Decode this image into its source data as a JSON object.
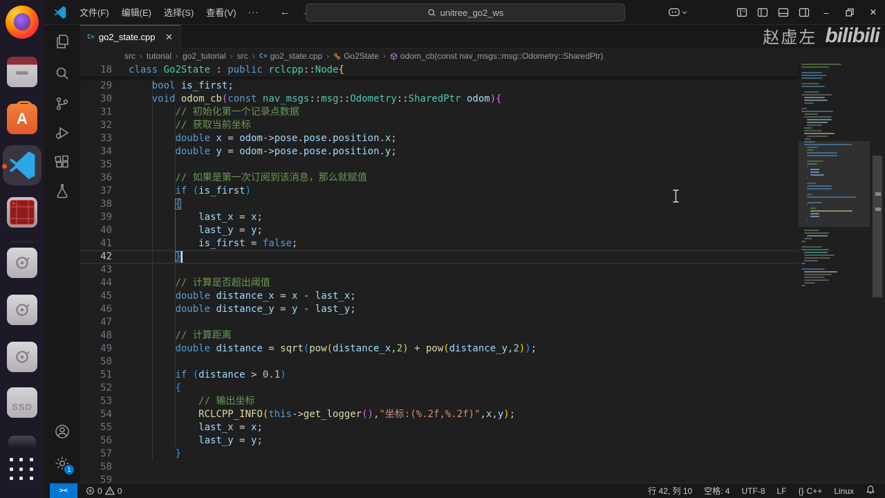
{
  "titlebar": {
    "menus": [
      "文件(F)",
      "编辑(E)",
      "选择(S)",
      "查看(V)"
    ],
    "overflow_label": "···",
    "back_label": "←",
    "forward_label": "→",
    "search": {
      "value": "unitree_go2_ws"
    },
    "icons": [
      "vscode-logo",
      "copilot-icon",
      "customize-layout-icon",
      "toggle-sidebar-icon",
      "toggle-panel-icon",
      "toggle-secondary-sidebar-icon"
    ],
    "window_controls": {
      "minimize": "–",
      "restore": "restore-icon",
      "close": "✕"
    }
  },
  "watermark": {
    "author": "赵虚左",
    "brand": "bilibili"
  },
  "dock": {
    "items": [
      "firefox",
      "files",
      "software-store",
      "vscode-active",
      "terminal",
      "disk-1",
      "disk-2",
      "disk-3",
      "ssd-drive",
      "hidden-app",
      "show-applications"
    ],
    "ssd_label": "SSD"
  },
  "activity_bar": {
    "items": [
      "explorer",
      "search",
      "source-control",
      "run-debug",
      "extensions",
      "testing",
      "account",
      "settings"
    ],
    "settings_badge": "1"
  },
  "tab": {
    "label": "go2_state.cpp",
    "close": "✕",
    "icon": "C+"
  },
  "breadcrumbs": [
    {
      "label": "src",
      "icon": ""
    },
    {
      "label": "tutorial",
      "icon": ""
    },
    {
      "label": "go2_tutorial",
      "icon": ""
    },
    {
      "label": "src",
      "icon": ""
    },
    {
      "label": "go2_state.cpp",
      "icon": "cpp"
    },
    {
      "label": "Go2State",
      "icon": "class"
    },
    {
      "label": "odom_cb(const nav_msgs::msg::Odometry::SharedPtr)",
      "icon": "method"
    }
  ],
  "editor": {
    "cursor_line": 42,
    "cursor_col": 10,
    "sticky": {
      "n": 18,
      "s": [
        [
          "class",
          "kw"
        ],
        [
          " ",
          "txt"
        ],
        [
          "Go2State",
          "type"
        ],
        [
          " : ",
          "txt"
        ],
        [
          "public",
          "kw"
        ],
        [
          " ",
          "txt"
        ],
        [
          "rclcpp",
          "type"
        ],
        [
          "::",
          "txt"
        ],
        [
          "Node",
          "type"
        ],
        [
          "{",
          "b1"
        ]
      ]
    },
    "lines": [
      {
        "n": 29,
        "s": [
          [
            "    ",
            "txt"
          ],
          [
            "bool",
            "kw"
          ],
          [
            " ",
            "txt"
          ],
          [
            "is_first",
            "var"
          ],
          [
            ";",
            "txt"
          ]
        ]
      },
      {
        "n": 30,
        "s": [
          [
            "    ",
            "txt"
          ],
          [
            "void",
            "kw"
          ],
          [
            " ",
            "txt"
          ],
          [
            "odom_cb",
            "fn"
          ],
          [
            "(",
            "b2"
          ],
          [
            "const",
            "kw"
          ],
          [
            " ",
            "txt"
          ],
          [
            "nav_msgs",
            "type"
          ],
          [
            "::",
            "txt"
          ],
          [
            "msg",
            "type"
          ],
          [
            "::",
            "txt"
          ],
          [
            "Odometry",
            "type"
          ],
          [
            "::",
            "txt"
          ],
          [
            "SharedPtr",
            "type"
          ],
          [
            " ",
            "txt"
          ],
          [
            "odom",
            "var"
          ],
          [
            ")",
            "b2"
          ],
          [
            "{",
            "b2"
          ]
        ]
      },
      {
        "n": 31,
        "s": [
          [
            "        ",
            "txt"
          ],
          [
            "// 初始化第一个记录点数据",
            "cm"
          ]
        ]
      },
      {
        "n": 32,
        "s": [
          [
            "        ",
            "txt"
          ],
          [
            "// 获取当前坐标",
            "cm"
          ]
        ]
      },
      {
        "n": 33,
        "s": [
          [
            "        ",
            "txt"
          ],
          [
            "double",
            "kw"
          ],
          [
            " ",
            "txt"
          ],
          [
            "x",
            "var"
          ],
          [
            " = ",
            "txt"
          ],
          [
            "odom",
            "var"
          ],
          [
            "->",
            "txt"
          ],
          [
            "pose",
            "var"
          ],
          [
            ".",
            "txt"
          ],
          [
            "pose",
            "var"
          ],
          [
            ".",
            "txt"
          ],
          [
            "position",
            "var"
          ],
          [
            ".",
            "txt"
          ],
          [
            "x",
            "var"
          ],
          [
            ";",
            "txt"
          ]
        ]
      },
      {
        "n": 34,
        "s": [
          [
            "        ",
            "txt"
          ],
          [
            "double",
            "kw"
          ],
          [
            " ",
            "txt"
          ],
          [
            "y",
            "var"
          ],
          [
            " = ",
            "txt"
          ],
          [
            "odom",
            "var"
          ],
          [
            "->",
            "txt"
          ],
          [
            "pose",
            "var"
          ],
          [
            ".",
            "txt"
          ],
          [
            "pose",
            "var"
          ],
          [
            ".",
            "txt"
          ],
          [
            "position",
            "var"
          ],
          [
            ".",
            "txt"
          ],
          [
            "y",
            "var"
          ],
          [
            ";",
            "txt"
          ]
        ]
      },
      {
        "n": 35,
        "s": []
      },
      {
        "n": 36,
        "s": [
          [
            "        ",
            "txt"
          ],
          [
            "// 如果是第一次订阅到该消息，那么就赋值",
            "cm"
          ]
        ]
      },
      {
        "n": 37,
        "s": [
          [
            "        ",
            "txt"
          ],
          [
            "if",
            "kw"
          ],
          [
            " ",
            "txt"
          ],
          [
            "(",
            "b3"
          ],
          [
            "is_first",
            "var"
          ],
          [
            ")",
            "b3"
          ]
        ]
      },
      {
        "n": 38,
        "s": [
          [
            "        ",
            "txt"
          ],
          [
            "{",
            "b3m"
          ]
        ]
      },
      {
        "n": 39,
        "s": [
          [
            "            ",
            "txt"
          ],
          [
            "last_x",
            "var"
          ],
          [
            " = ",
            "txt"
          ],
          [
            "x",
            "var"
          ],
          [
            ";",
            "txt"
          ]
        ]
      },
      {
        "n": 40,
        "s": [
          [
            "            ",
            "txt"
          ],
          [
            "last_y",
            "var"
          ],
          [
            " = ",
            "txt"
          ],
          [
            "y",
            "var"
          ],
          [
            ";",
            "txt"
          ]
        ]
      },
      {
        "n": 41,
        "s": [
          [
            "            ",
            "txt"
          ],
          [
            "is_first",
            "var"
          ],
          [
            " = ",
            "txt"
          ],
          [
            "false",
            "kw"
          ],
          [
            ";",
            "txt"
          ]
        ]
      },
      {
        "n": 42,
        "s": [
          [
            "        ",
            "txt"
          ],
          [
            "}",
            "b3m"
          ]
        ]
      },
      {
        "n": 43,
        "s": []
      },
      {
        "n": 44,
        "s": [
          [
            "        ",
            "txt"
          ],
          [
            "// 计算是否超出阈值",
            "cm"
          ]
        ]
      },
      {
        "n": 45,
        "s": [
          [
            "        ",
            "txt"
          ],
          [
            "double",
            "kw"
          ],
          [
            " ",
            "txt"
          ],
          [
            "distance_x",
            "var"
          ],
          [
            " = ",
            "txt"
          ],
          [
            "x",
            "var"
          ],
          [
            " - ",
            "txt"
          ],
          [
            "last_x",
            "var"
          ],
          [
            ";",
            "txt"
          ]
        ]
      },
      {
        "n": 46,
        "s": [
          [
            "        ",
            "txt"
          ],
          [
            "double",
            "kw"
          ],
          [
            " ",
            "txt"
          ],
          [
            "distance_y",
            "var"
          ],
          [
            " = ",
            "txt"
          ],
          [
            "y",
            "var"
          ],
          [
            " - ",
            "txt"
          ],
          [
            "last_y",
            "var"
          ],
          [
            ";",
            "txt"
          ]
        ]
      },
      {
        "n": 47,
        "s": []
      },
      {
        "n": 48,
        "s": [
          [
            "        ",
            "txt"
          ],
          [
            "// 计算距离",
            "cm"
          ]
        ]
      },
      {
        "n": 49,
        "s": [
          [
            "        ",
            "txt"
          ],
          [
            "double",
            "kw"
          ],
          [
            " ",
            "txt"
          ],
          [
            "distance",
            "var"
          ],
          [
            " = ",
            "txt"
          ],
          [
            "sqrt",
            "fn"
          ],
          [
            "(",
            "b3"
          ],
          [
            "pow",
            "fn"
          ],
          [
            "(",
            "b1"
          ],
          [
            "distance_x",
            "var"
          ],
          [
            ",",
            "txt"
          ],
          [
            "2",
            "num"
          ],
          [
            ")",
            "b1"
          ],
          [
            " + ",
            "txt"
          ],
          [
            "pow",
            "fn"
          ],
          [
            "(",
            "b1"
          ],
          [
            "distance_y",
            "var"
          ],
          [
            ",",
            "txt"
          ],
          [
            "2",
            "num"
          ],
          [
            ")",
            "b1"
          ],
          [
            ")",
            "b3"
          ],
          [
            ";",
            "txt"
          ]
        ]
      },
      {
        "n": 50,
        "s": []
      },
      {
        "n": 51,
        "s": [
          [
            "        ",
            "txt"
          ],
          [
            "if",
            "kw"
          ],
          [
            " ",
            "txt"
          ],
          [
            "(",
            "b3"
          ],
          [
            "distance",
            "var"
          ],
          [
            " > ",
            "txt"
          ],
          [
            "0.1",
            "num"
          ],
          [
            ")",
            "b3"
          ]
        ]
      },
      {
        "n": 52,
        "s": [
          [
            "        ",
            "txt"
          ],
          [
            "{",
            "b3"
          ]
        ]
      },
      {
        "n": 53,
        "s": [
          [
            "            ",
            "txt"
          ],
          [
            "// 输出坐标",
            "cm"
          ]
        ]
      },
      {
        "n": 54,
        "s": [
          [
            "            ",
            "txt"
          ],
          [
            "RCLCPP_INFO",
            "fn"
          ],
          [
            "(",
            "b1"
          ],
          [
            "this",
            "kw"
          ],
          [
            "->",
            "txt"
          ],
          [
            "get_logger",
            "fn"
          ],
          [
            "(",
            "b2"
          ],
          [
            ")",
            "b2"
          ],
          [
            ",",
            "txt"
          ],
          [
            "\"坐标:(%.2f,%.2f)\"",
            "str"
          ],
          [
            ",",
            "txt"
          ],
          [
            "x",
            "var"
          ],
          [
            ",",
            "txt"
          ],
          [
            "y",
            "var"
          ],
          [
            ")",
            "b1"
          ],
          [
            ";",
            "txt"
          ]
        ]
      },
      {
        "n": 55,
        "s": [
          [
            "            ",
            "txt"
          ],
          [
            "last_x",
            "var"
          ],
          [
            " = ",
            "txt"
          ],
          [
            "x",
            "var"
          ],
          [
            ";",
            "txt"
          ]
        ]
      },
      {
        "n": 56,
        "s": [
          [
            "            ",
            "txt"
          ],
          [
            "last_y",
            "var"
          ],
          [
            " = ",
            "txt"
          ],
          [
            "y",
            "var"
          ],
          [
            ";",
            "txt"
          ]
        ]
      },
      {
        "n": 57,
        "s": [
          [
            "        ",
            "txt"
          ],
          [
            "}",
            "b3"
          ]
        ]
      },
      {
        "n": 58,
        "s": []
      },
      {
        "n": 59,
        "s": []
      }
    ],
    "minimap": {
      "upper": [
        [
          0,
          58,
          "cm"
        ],
        [
          0,
          40,
          "cm"
        ],
        [
          0,
          0,
          "txt"
        ],
        [
          0,
          30,
          "kw"
        ],
        [
          0,
          36,
          "kw"
        ],
        [
          0,
          30,
          "kw"
        ],
        [
          0,
          0,
          "txt"
        ],
        [
          0,
          26,
          "cm"
        ],
        [
          0,
          34,
          "kw"
        ],
        [
          0,
          0,
          "txt"
        ],
        [
          4,
          22,
          "cm"
        ],
        [
          0,
          44,
          "txt"
        ],
        [
          4,
          30,
          "var"
        ],
        [
          4,
          34,
          "var"
        ],
        [
          4,
          14,
          "txt"
        ],
        [
          0,
          0,
          "txt"
        ],
        [
          0,
          8,
          "txt"
        ],
        [
          0,
          46,
          "kw"
        ],
        [
          4,
          20,
          "cm"
        ],
        [
          4,
          40,
          "txt"
        ],
        [
          8,
          36,
          "var"
        ],
        [
          8,
          30,
          "var"
        ],
        [
          8,
          22,
          "txt"
        ],
        [
          4,
          12,
          "txt"
        ],
        [
          4,
          26,
          "cm"
        ],
        [
          4,
          44,
          "fn"
        ],
        [
          8,
          30,
          "txt"
        ],
        [
          4,
          10,
          "txt"
        ]
      ],
      "lower": [
        [
          4,
          0,
          "txt"
        ],
        [
          4,
          22,
          "cm"
        ],
        [
          4,
          36,
          "txt"
        ],
        [
          8,
          30,
          "var"
        ],
        [
          4,
          12,
          "txt"
        ],
        [
          0,
          6,
          "txt"
        ],
        [
          0,
          0,
          "txt"
        ],
        [
          0,
          30,
          "cm"
        ],
        [
          0,
          40,
          "kw"
        ],
        [
          4,
          34,
          "type"
        ],
        [
          4,
          44,
          "txt"
        ],
        [
          4,
          38,
          "txt"
        ],
        [
          4,
          20,
          "txt"
        ],
        [
          0,
          6,
          "txt"
        ],
        [
          0,
          0,
          "txt"
        ],
        [
          0,
          34,
          "kw"
        ],
        [
          4,
          48,
          "fn"
        ],
        [
          4,
          40,
          "txt"
        ],
        [
          4,
          30,
          "txt"
        ],
        [
          4,
          36,
          "txt"
        ],
        [
          4,
          16,
          "txt"
        ],
        [
          0,
          6,
          "txt"
        ],
        [
          0,
          0,
          "txt"
        ],
        [
          0,
          0,
          "txt"
        ],
        [
          0,
          0,
          "txt"
        ],
        [
          0,
          0,
          "txt"
        ],
        [
          0,
          0,
          "txt"
        ],
        [
          0,
          0,
          "txt"
        ],
        [
          0,
          0,
          "txt"
        ],
        [
          0,
          0,
          "txt"
        ],
        [
          0,
          0,
          "txt"
        ]
      ]
    }
  },
  "status_bar": {
    "remote_label": "><",
    "errors": "0",
    "warnings": "0",
    "items": [
      {
        "name": "cursor-position",
        "label": "行 42, 列 10"
      },
      {
        "name": "indentation",
        "label": "空格: 4"
      },
      {
        "name": "encoding",
        "label": "UTF-8"
      },
      {
        "name": "eol",
        "label": "LF"
      },
      {
        "name": "language-mode",
        "label": "C++",
        "icon": "{}"
      },
      {
        "name": "remote-os",
        "label": "Linux"
      }
    ]
  },
  "colors": {
    "accent": "#0078d4",
    "editor_bg": "#1f1f1f",
    "chrome_bg": "#181818",
    "remote_bg": "#0078d4"
  }
}
